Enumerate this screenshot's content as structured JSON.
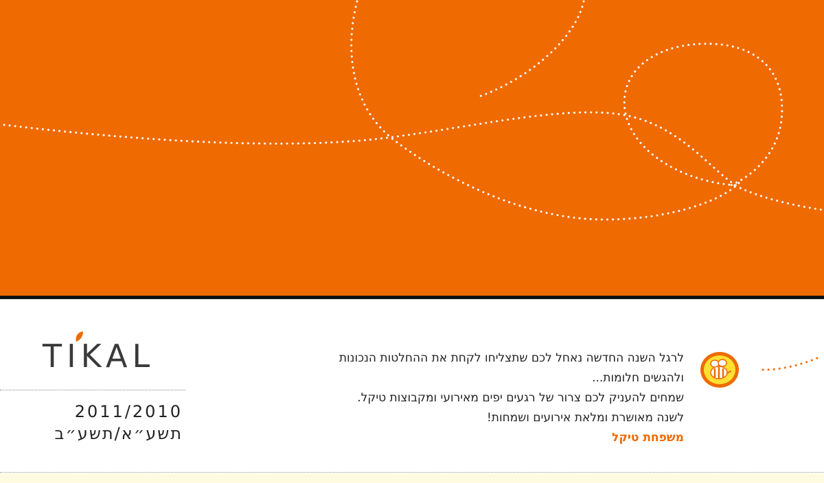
{
  "colors": {
    "banner": "#ef6a00",
    "accent": "#ef6a00",
    "bar": "#111111",
    "text": "#222222",
    "footer": "#fffbe1"
  },
  "logo": {
    "text": "TIKAL"
  },
  "year": {
    "numeric": "2011/2010",
    "hebrew": "תשע״א/תשע״ב"
  },
  "message": {
    "line1": "לרגל השנה החדשה נאחל לכם שתצליחו לקחת את ההחלטות הנכונות",
    "line2": "ולהגשים חלומות...",
    "line3": "שמחים להעניק לכם צרור של רגעים יפים מאירועי ומקבוצות טיקל.",
    "line4": "לשנה מאושרת ומלאת אירועים ושמחות!",
    "signature": "משפחת טיקל"
  },
  "icons": {
    "badge": "bee-icon",
    "leaf": "leaf-icon"
  }
}
